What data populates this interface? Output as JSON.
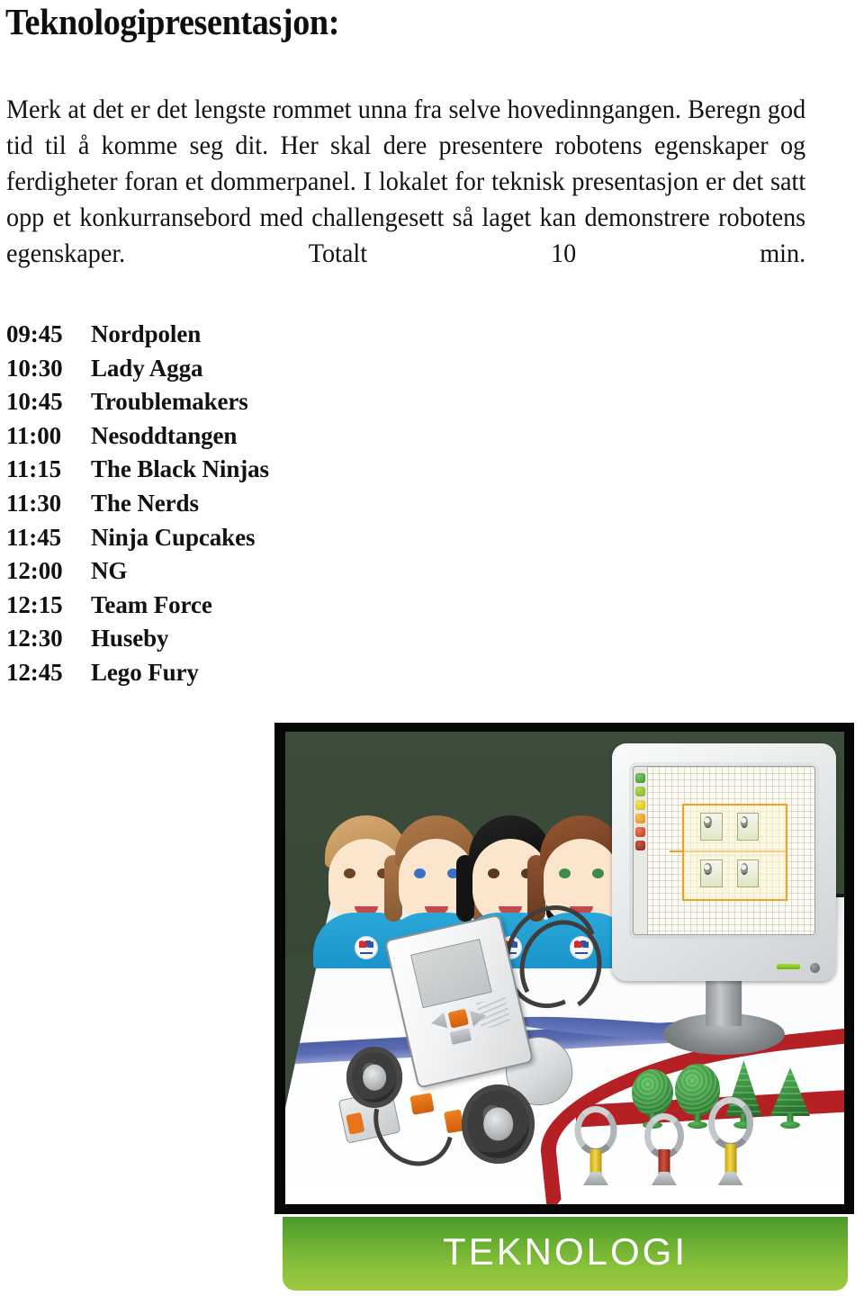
{
  "page": {
    "title": "Teknologipresentasjon:",
    "intro": "Merk at det er det lengste rommet unna fra selve hovedinngangen. Beregn god tid til å komme seg dit. Her skal dere presentere robotens egenskaper og ferdigheter foran et dommerpanel. I lokalet for teknisk presentasjon er det satt opp et konkurransebord med challengesett så laget kan demonstrere robotens egenskaper. Totalt 10 min."
  },
  "schedule": {
    "rows": [
      {
        "time": "09:45",
        "team": "Nordpolen"
      },
      {
        "time": "10:30",
        "team": "Lady Agga"
      },
      {
        "time": "10:45",
        "team": "Troublemakers"
      },
      {
        "time": "11:00",
        "team": "Nesoddtangen"
      },
      {
        "time": "11:15",
        "team": "The Black Ninjas"
      },
      {
        "time": "11:30",
        "team": "The Nerds"
      },
      {
        "time": "11:45",
        "team": "Ninja Cupcakes"
      },
      {
        "time": "12:00",
        "team": "NG"
      },
      {
        "time": "12:15",
        "team": "Team Force"
      },
      {
        "time": "12:30",
        "team": "Huseby"
      },
      {
        "time": "12:45",
        "team": "Lego Fury"
      }
    ]
  },
  "illustration": {
    "category_label": "TEKNOLOGI",
    "colors": {
      "banner_top": "#4b9a2a",
      "banner_bottom": "#9ec941",
      "frame": "#060606",
      "backdrop_green": "#3b4a39",
      "shirt_blue": "#2aa8d8",
      "mat_red": "#b52025",
      "mat_blue": "#5b6cb4",
      "lego_green": "#2f8333",
      "nxt_orange": "#f0801f"
    },
    "scene_elements": [
      "team-members",
      "computer-monitor",
      "nxt-programming-software",
      "lego-mindstorms-robot",
      "competition-mat",
      "lego-trees",
      "lego-loops"
    ],
    "team_members": [
      {
        "name": "member-1",
        "hair": "#c69a63",
        "eyes": "#6b4423",
        "style": "short"
      },
      {
        "name": "member-2",
        "hair": "#9a6b42",
        "eyes": "#3a6fc4",
        "style": "long"
      },
      {
        "name": "member-3",
        "hair": "#121212",
        "eyes": "#5a3a1e",
        "style": "bob"
      },
      {
        "name": "member-4",
        "hair": "#7d4a2c",
        "eyes": "#3f8c4a",
        "style": "long"
      }
    ],
    "palette_chips": [
      "#4f9e34",
      "#8cc63f",
      "#e8d81f",
      "#f2a21d",
      "#d9492a",
      "#b03427"
    ],
    "loops": [
      {
        "name": "loop-yellow-1",
        "stem": "#e8c722"
      },
      {
        "name": "loop-red",
        "stem": "#b93b2c"
      },
      {
        "name": "loop-yellow-2",
        "stem": "#e8c722"
      }
    ]
  }
}
